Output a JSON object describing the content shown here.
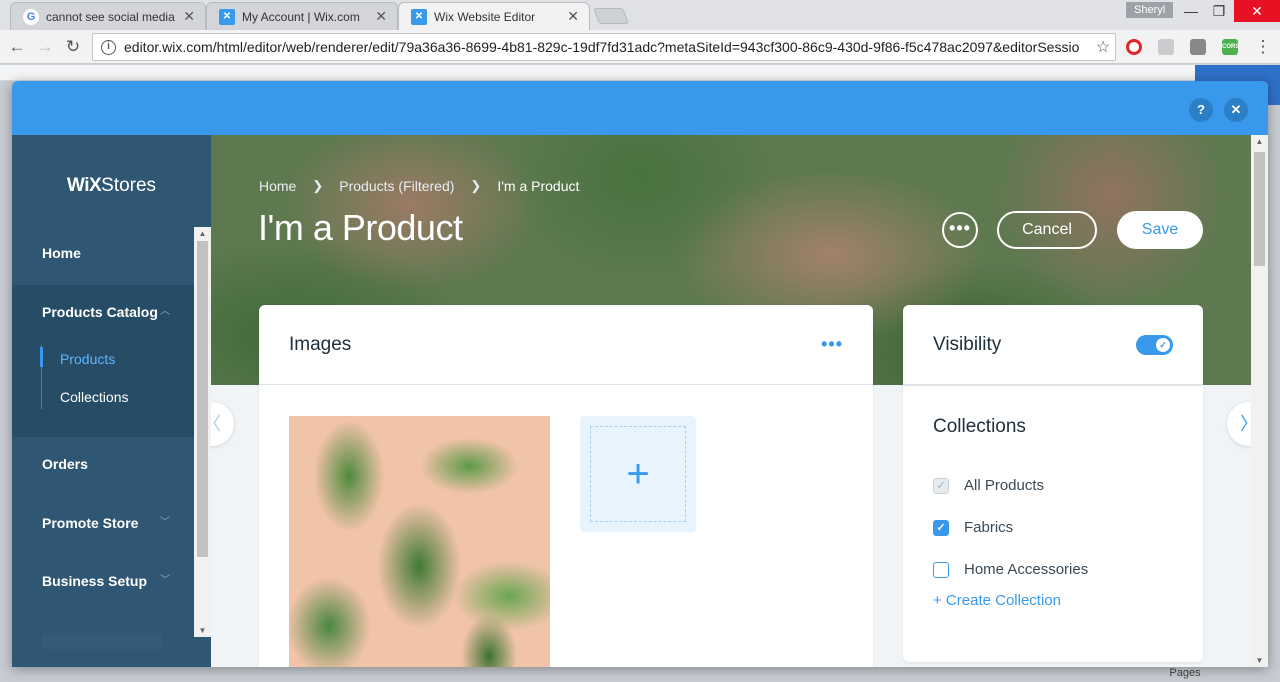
{
  "browser": {
    "tabs": [
      {
        "title": "cannot see social media",
        "favicon": "google-icon",
        "active": false
      },
      {
        "title": "My Account | Wix.com",
        "favicon": "wix-icon",
        "active": false
      },
      {
        "title": "Wix Website Editor",
        "favicon": "wix-icon",
        "active": true
      }
    ],
    "profile_name": "Sheryl",
    "url": "editor.wix.com/html/editor/web/renderer/edit/79a36a36-8699-4b81-829c-19df7fd31adc?metaSiteId=943cf300-86c9-430d-9f86-f5c478ac2097&editorSessio",
    "ext_cors_label": "CORS"
  },
  "editor_bg": {
    "pages_label": "Pages"
  },
  "modal": {
    "help_label": "?",
    "close_label": "✕",
    "brand": {
      "wix": "WiX",
      "stores": "Stores"
    },
    "sidebar": {
      "home": "Home",
      "products_catalog": "Products Catalog",
      "products": "Products",
      "collections": "Collections",
      "orders": "Orders",
      "promote_store": "Promote Store",
      "business_setup": "Business Setup"
    },
    "breadcrumb": {
      "home": "Home",
      "filtered": "Products (Filtered)",
      "current": "I'm a Product"
    },
    "page_title": "I'm a Product",
    "actions": {
      "more": "•••",
      "cancel": "Cancel",
      "save": "Save"
    },
    "images_card": {
      "title": "Images",
      "more": "•••"
    },
    "visibility": {
      "title": "Visibility",
      "enabled": true
    },
    "collections": {
      "title": "Collections",
      "items": [
        {
          "label": "All Products",
          "state": "disabled-checked"
        },
        {
          "label": "Fabrics",
          "state": "checked"
        },
        {
          "label": "Home Accessories",
          "state": "unchecked"
        }
      ],
      "create_link": "+ Create Collection"
    }
  },
  "colors": {
    "accent": "#3899ec",
    "sidebar": "#2f5773",
    "sidebar_active_block": "#274c66"
  }
}
